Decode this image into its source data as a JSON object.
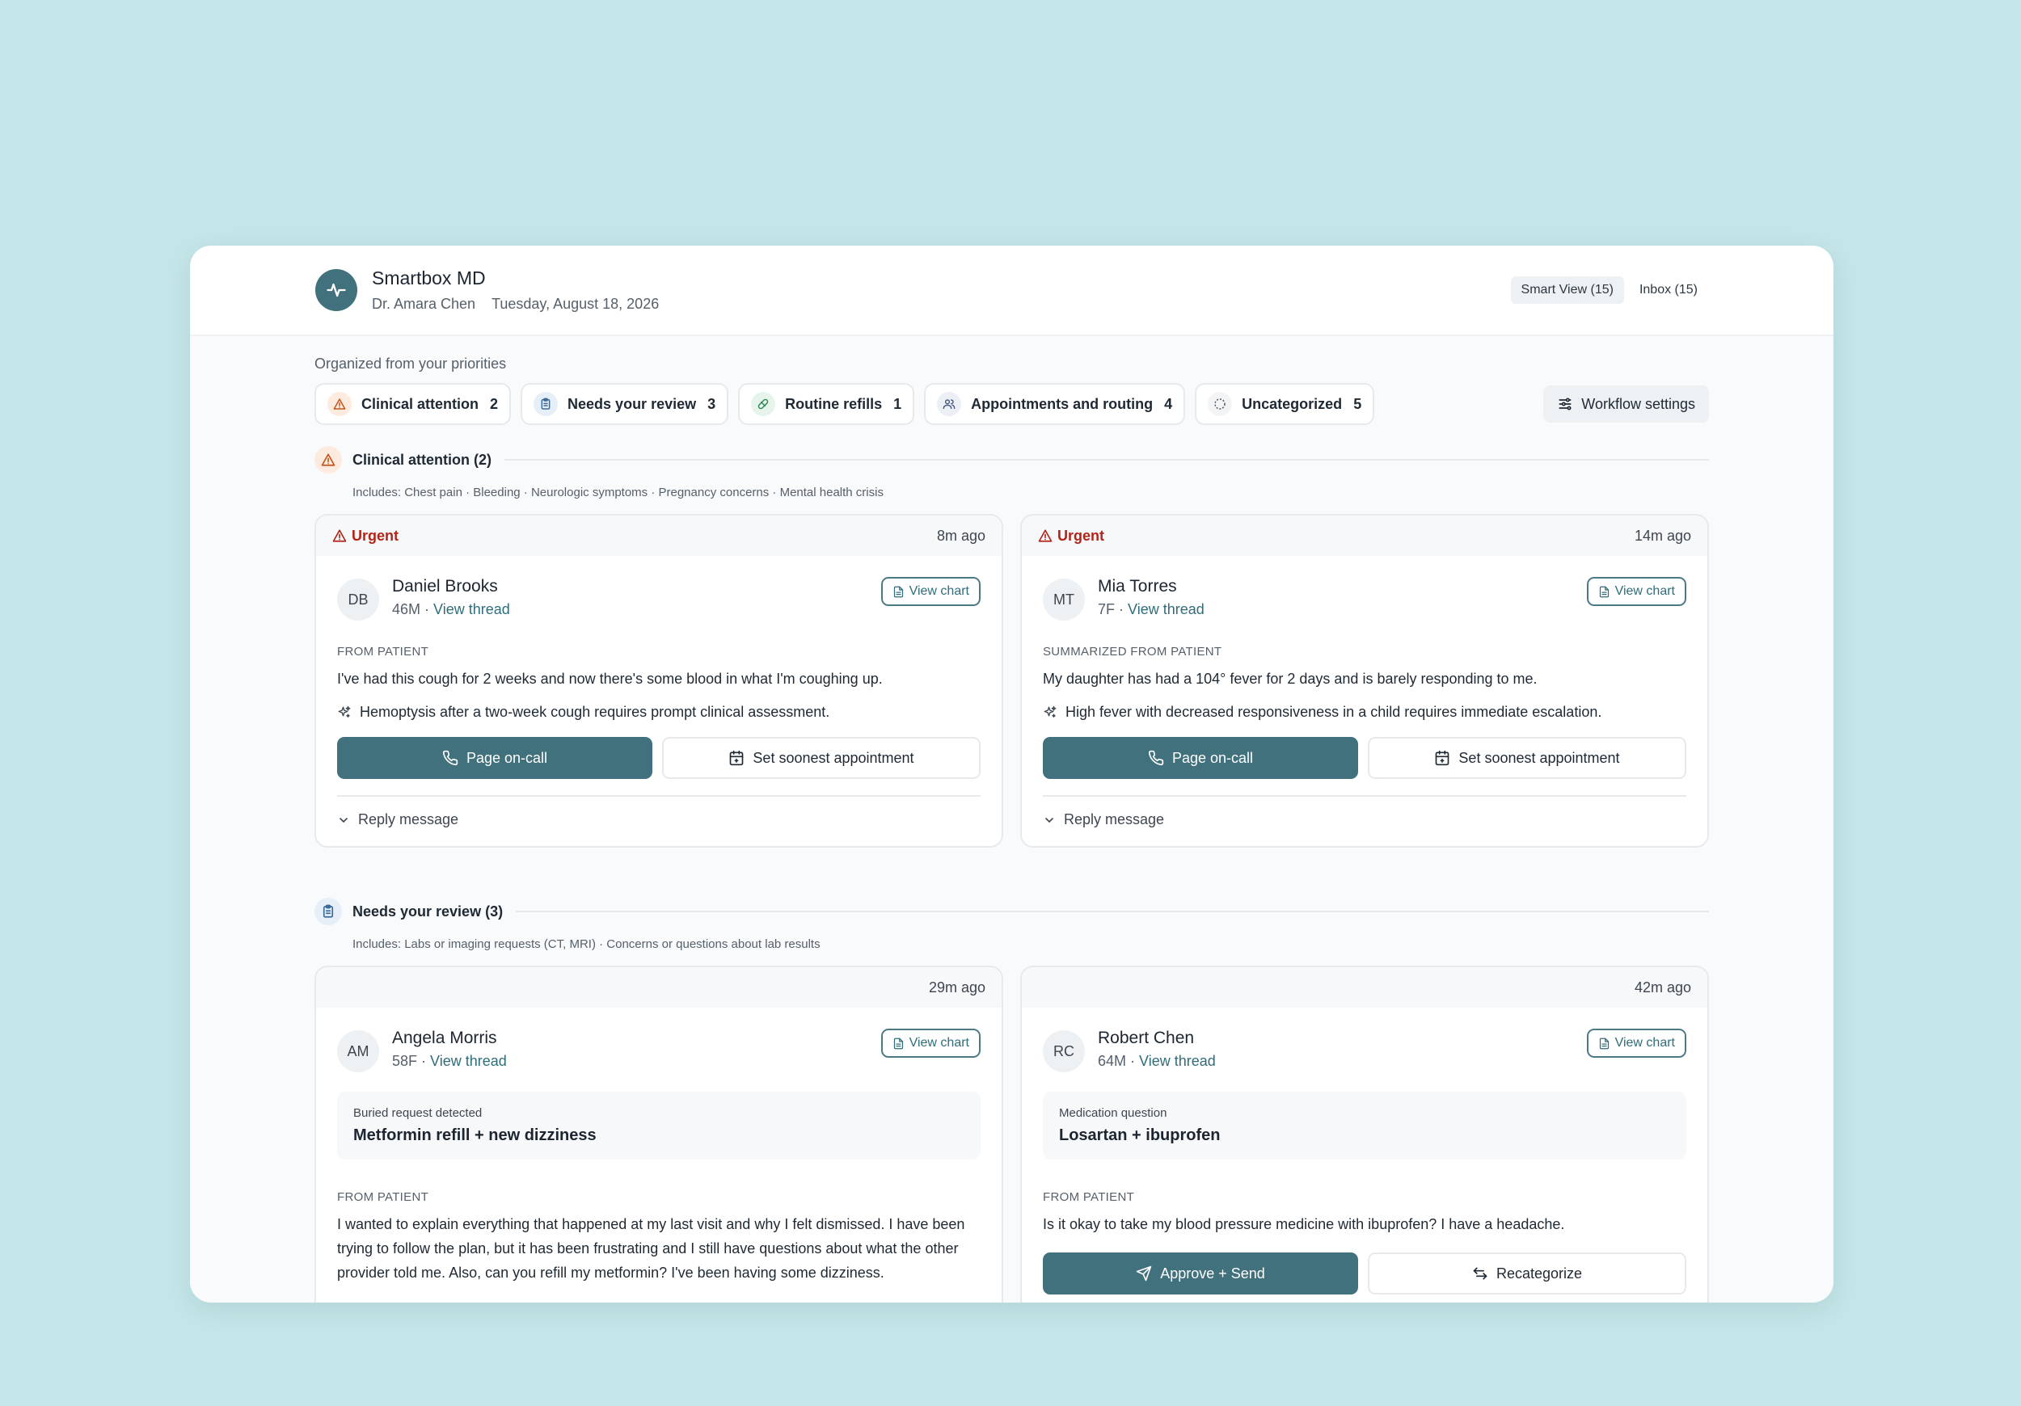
{
  "app": {
    "title": "Smartbox MD",
    "doctor": "Dr. Amara Chen",
    "date": "Tuesday, August 18, 2026",
    "views": [
      "Smart View (15)",
      "Inbox (15)"
    ]
  },
  "organized_label": "Organized from your priorities",
  "filters": [
    {
      "label": "Clinical attention",
      "count": "2"
    },
    {
      "label": "Needs your review",
      "count": "3"
    },
    {
      "label": "Routine refills",
      "count": "1"
    },
    {
      "label": "Appointments and routing",
      "count": "4"
    },
    {
      "label": "Uncategorized",
      "count": "5"
    }
  ],
  "workflow_settings": "Workflow settings",
  "sections": {
    "clinical": {
      "title": "Clinical attention (2)",
      "includes": "Includes: Chest pain · Bleeding · Neurologic symptoms · Pregnancy concerns · Mental health crisis",
      "cards": [
        {
          "badge": "Urgent",
          "ago": "8m ago",
          "initials": "DB",
          "name": "Daniel Brooks",
          "meta": "46M · ",
          "thread": "View thread",
          "chart": "View chart",
          "source": "FROM PATIENT",
          "message": "I've had this cough for 2 weeks and now there's some blood in what I'm coughing up.",
          "ai": "Hemoptysis after a two-week cough requires prompt clinical assessment.",
          "primary": "Page on-call",
          "secondary": "Set soonest appointment",
          "reply": "Reply message"
        },
        {
          "badge": "Urgent",
          "ago": "14m ago",
          "initials": "MT",
          "name": "Mia Torres",
          "meta": "7F · ",
          "thread": "View thread",
          "chart": "View chart",
          "source": "SUMMARIZED FROM PATIENT",
          "message": "My daughter has had a 104° fever for 2 days and is barely responding to me.",
          "ai": "High fever with decreased responsiveness in a child requires immediate escalation.",
          "primary": "Page on-call",
          "secondary": "Set soonest appointment",
          "reply": "Reply message"
        }
      ]
    },
    "review": {
      "title": "Needs your review (3)",
      "includes": "Includes: Labs or imaging requests (CT, MRI) · Concerns or questions about lab results",
      "cards": [
        {
          "ago": "29m ago",
          "initials": "AM",
          "name": "Angela Morris",
          "meta": "58F · ",
          "thread": "View thread",
          "chart": "View chart",
          "insight_label": "Buried request detected",
          "insight_title": "Metformin refill + new dizziness",
          "source": "FROM PATIENT",
          "message": "I wanted to explain everything that happened at my last visit and why I felt dismissed. I have been trying to follow the plan, but it has been frustrating and I still have questions about what the other provider told me. Also, can you refill my metformin? I've been having some dizziness."
        },
        {
          "ago": "42m ago",
          "initials": "RC",
          "name": "Robert Chen",
          "meta": "64M · ",
          "thread": "View thread",
          "chart": "View chart",
          "insight_label": "Medication question",
          "insight_title": "Losartan + ibuprofen",
          "source": "FROM PATIENT",
          "message": "Is it okay to take my blood pressure medicine with ibuprofen? I have a headache.",
          "primary": "Approve + Send",
          "secondary": "Recategorize"
        }
      ]
    }
  },
  "colors": {
    "background": "#c5e6e8",
    "accent": "#41717d",
    "urgent": "#b42318",
    "link": "#2f6d7b"
  }
}
